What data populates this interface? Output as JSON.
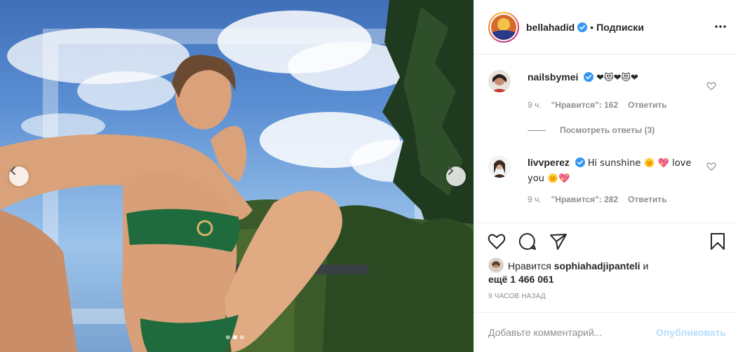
{
  "post": {
    "slide_count": 3,
    "active_slide_index": 1
  },
  "header": {
    "username": "bellahadid",
    "separator": "•",
    "follow_status": "Подписки"
  },
  "comments": [
    {
      "username": "nailsbymei",
      "text": "❤😻❤😻❤",
      "time": "9 ч.",
      "likes": "\"Нравится\": 162",
      "reply_label": "Ответить"
    },
    {
      "username": "livvperez",
      "text": "Hi sunshine 🌞 💖 love you 🌞💖",
      "time": "9 ч.",
      "likes": "\"Нравится\": 282",
      "reply_label": "Ответить"
    }
  ],
  "view_replies": "Посмотреть ответы (3)",
  "likes_line": {
    "prefix": "Нравится",
    "user": "sophiahadjipanteli",
    "middle": "и",
    "more": "ещё 1 466 061"
  },
  "timestamp": "9 ЧАСОВ НАЗАД",
  "add_comment": {
    "placeholder": "Добавьте комментарий...",
    "publish_label": "Опубликовать"
  },
  "colors": {
    "verified": "#3897f0",
    "publish_disabled": "#b2dffc",
    "muted_text": "#8e8e8e"
  }
}
